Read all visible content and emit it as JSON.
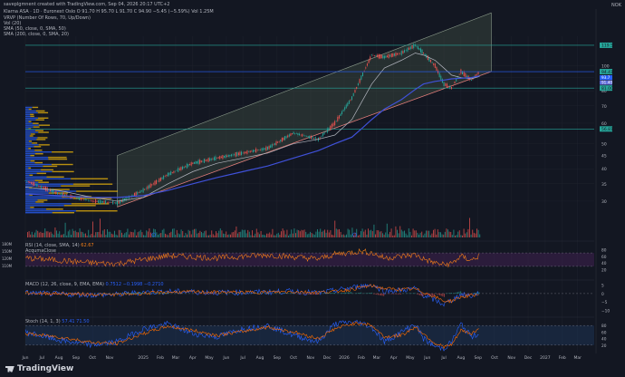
{
  "header": {
    "created_by": "saveplgmnent created with TradingView.com, Sep 04, 2026 20:17 UTC+2",
    "symbol_line": "Klarna ASA · 1D · Euronext Oslo",
    "ohlc": "O 91.70 H 95.70 L 91.70 C 94.90 −5.45 (−5.59%)",
    "vol_text": "Vol 1.25M",
    "vrvp": "VRVP (Number Of Rows, 70, Up/Down)",
    "vol20": "Vol (20)",
    "sma50": "SMA (50, close, 0, SMA, 50)",
    "sma200": "SMA (200, close, 0, SMA, 20)",
    "rsi": "RSI (14, close, SMA, 14)",
    "rsi_value": "62.67",
    "rsi_sub": "AcqumaClose",
    "macd": "MACD (12, 26, close, 9, EMA, EMA)",
    "macd_values": "0.7512  −0.1998  −0.2710",
    "stoch": "Stoch (14, 1, 3)",
    "stoch_values": "57.41  71.50",
    "volume_axis": [
      "180M",
      "150M",
      "120M",
      "110M"
    ]
  },
  "branding": {
    "name": "TradingView"
  },
  "top_right": {
    "currency": "NOK"
  },
  "colors": {
    "bg": "#131722",
    "up": "#26a69a",
    "down": "#ef5350",
    "sma50": "#b2b5be",
    "sma200": "#3f51d9",
    "channel": "#4a5d4a",
    "vol_up": "#2962ff",
    "vol_down": "#f0b90b",
    "level": "#26a69a",
    "price_line": "#2962ff",
    "rsi": "#f57f17",
    "rsi_band": "#4a235a",
    "macd": "#2962ff",
    "signal": "#ff6d00",
    "stoch_k": "#2962ff",
    "stoch_d": "#ff6d00",
    "stoch_band": "#1e3a5f"
  },
  "chart_data": [
    {
      "type": "line",
      "title": "Klarna ASA · 1D",
      "x_ticks": [
        "Jun",
        "Jul",
        "Aug",
        "Sep",
        "Oct",
        "Nov",
        "2025",
        "Feb",
        "Mar",
        "Apr",
        "May",
        "Jun",
        "Jul",
        "Aug",
        "Sep",
        "Oct",
        "Nov",
        "Dec",
        "2026",
        "Feb",
        "Mar",
        "Apr",
        "May",
        "Jun",
        "Jul",
        "Aug",
        "Sep",
        "Oct",
        "Nov",
        "Dec",
        "2027",
        "Feb",
        "Mar"
      ],
      "y_ticks": [
        30,
        35,
        40,
        45,
        50,
        60,
        70,
        80,
        90,
        100,
        120
      ],
      "ylim": [
        27,
        130
      ],
      "log_scale": true,
      "price_x": [
        "2024-06-01",
        "2024-08-01",
        "2024-10-01",
        "2024-11-15",
        "2025-01-01",
        "2025-02-15",
        "2025-04-01",
        "2025-05-15",
        "2025-07-01",
        "2025-08-15",
        "2025-10-01",
        "2025-11-15",
        "2025-12-15",
        "2026-01-15",
        "2026-02-01",
        "2026-02-20",
        "2026-03-15",
        "2026-04-15",
        "2026-05-10",
        "2026-05-25",
        "2026-06-15",
        "2026-07-01",
        "2026-07-15",
        "2026-08-01",
        "2026-08-20",
        "2026-09-04"
      ],
      "price": [
        36,
        32,
        30,
        29.5,
        33,
        38,
        42,
        44,
        46,
        48,
        55,
        52,
        60,
        75,
        90,
        110,
        108,
        112,
        120,
        112,
        100,
        85,
        82,
        95,
        88,
        94.9
      ],
      "sma50": [
        34,
        33,
        31,
        30,
        31,
        35,
        39,
        42,
        44,
        46,
        50,
        52,
        54,
        62,
        72,
        85,
        98,
        105,
        112,
        110,
        105,
        98,
        92,
        90,
        89,
        91
      ],
      "sma200": [
        32,
        31.5,
        31,
        31,
        31.5,
        33,
        35,
        37,
        39,
        41,
        44,
        47,
        50,
        53,
        57,
        62,
        68,
        74,
        81,
        85,
        87,
        88,
        89,
        89.5,
        90,
        91.4
      ],
      "levels": [
        {
          "value": 120.0,
          "label": "119.5"
        },
        {
          "value": 82.0,
          "label": "81.00"
        },
        {
          "value": 57.0,
          "label": "56.81"
        }
      ],
      "last_price": {
        "value": 94.9,
        "label": "94.41"
      },
      "sma50_last": {
        "label": "93.7"
      },
      "sma200_last": {
        "label": "91.40"
      }
    },
    {
      "type": "line",
      "title": "RSI (14, close)",
      "ylim": [
        0,
        100
      ],
      "band": [
        30,
        70
      ],
      "y_ticks": [
        80,
        60,
        40,
        20
      ],
      "values": [
        55,
        48,
        40,
        38,
        50,
        62,
        58,
        55,
        60,
        64,
        58,
        52,
        66,
        72,
        75,
        70,
        55,
        60,
        65,
        52,
        40,
        35,
        38,
        60,
        48,
        62.67
      ]
    },
    {
      "type": "line",
      "title": "MACD (12, 26, close, 9)",
      "ylim": [
        -12,
        7
      ],
      "y_ticks": [
        5,
        0,
        -5,
        -10
      ],
      "macd": [
        0.5,
        -0.4,
        -0.8,
        -0.6,
        0.8,
        1.2,
        1.0,
        0.6,
        0.7,
        0.9,
        1.4,
        0.2,
        1.8,
        3.5,
        4.5,
        5.2,
        1.5,
        2.0,
        3.0,
        -1.0,
        -4.0,
        -6.5,
        -4.0,
        -0.5,
        -1.5,
        0.75
      ],
      "signal": [
        0.3,
        0.0,
        -0.5,
        -0.6,
        0.1,
        0.8,
        1.0,
        0.8,
        0.7,
        0.8,
        1.1,
        0.7,
        1.2,
        2.5,
        3.8,
        4.6,
        3.0,
        2.4,
        2.7,
        0.8,
        -2.0,
        -4.5,
        -4.5,
        -2.0,
        -1.2,
        -0.2
      ]
    },
    {
      "type": "line",
      "title": "Stoch (14, 1, 3)",
      "ylim": [
        0,
        100
      ],
      "band": [
        20,
        80
      ],
      "y_ticks": [
        80,
        60,
        40,
        20
      ],
      "k": [
        60,
        35,
        20,
        30,
        70,
        85,
        55,
        45,
        70,
        80,
        50,
        30,
        85,
        90,
        88,
        75,
        30,
        60,
        85,
        40,
        15,
        10,
        30,
        85,
        45,
        57.41
      ],
      "d": [
        55,
        45,
        28,
        25,
        55,
        78,
        65,
        50,
        62,
        75,
        60,
        40,
        70,
        85,
        88,
        80,
        45,
        50,
        75,
        55,
        25,
        15,
        20,
        65,
        55,
        71.5
      ]
    }
  ]
}
